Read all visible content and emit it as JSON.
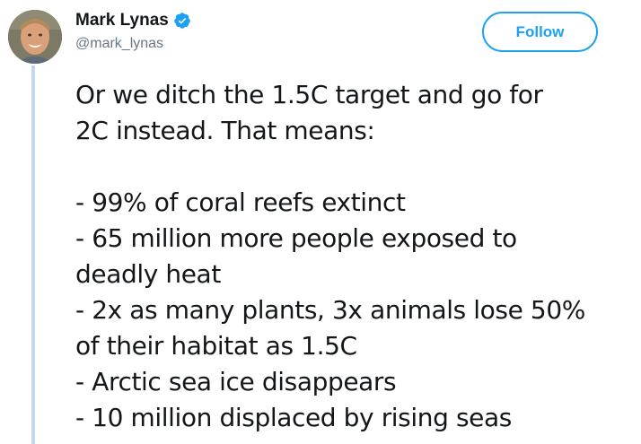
{
  "author": {
    "name": "Mark Lynas",
    "handle": "@mark_lynas",
    "verified": true
  },
  "follow_button": {
    "label": "Follow"
  },
  "tweet": {
    "intro_lines": [
      "Or we ditch the 1.5C target and go for",
      "2C instead. That means:"
    ],
    "body_lines": [
      "- 99% of coral reefs extinct",
      "- 65 million more people exposed to",
      "deadly heat",
      "- 2x as many plants, 3x animals lose 50%",
      "of their habitat as 1.5C",
      "- Arctic sea ice disappears",
      "- 10 million displaced by rising seas"
    ]
  },
  "colors": {
    "accent": "#1da1f2",
    "text": "#14171a",
    "secondary_text": "#657786",
    "thread_line": "#c4d7ee"
  },
  "icons": {
    "verified": "verified-badge-icon"
  }
}
